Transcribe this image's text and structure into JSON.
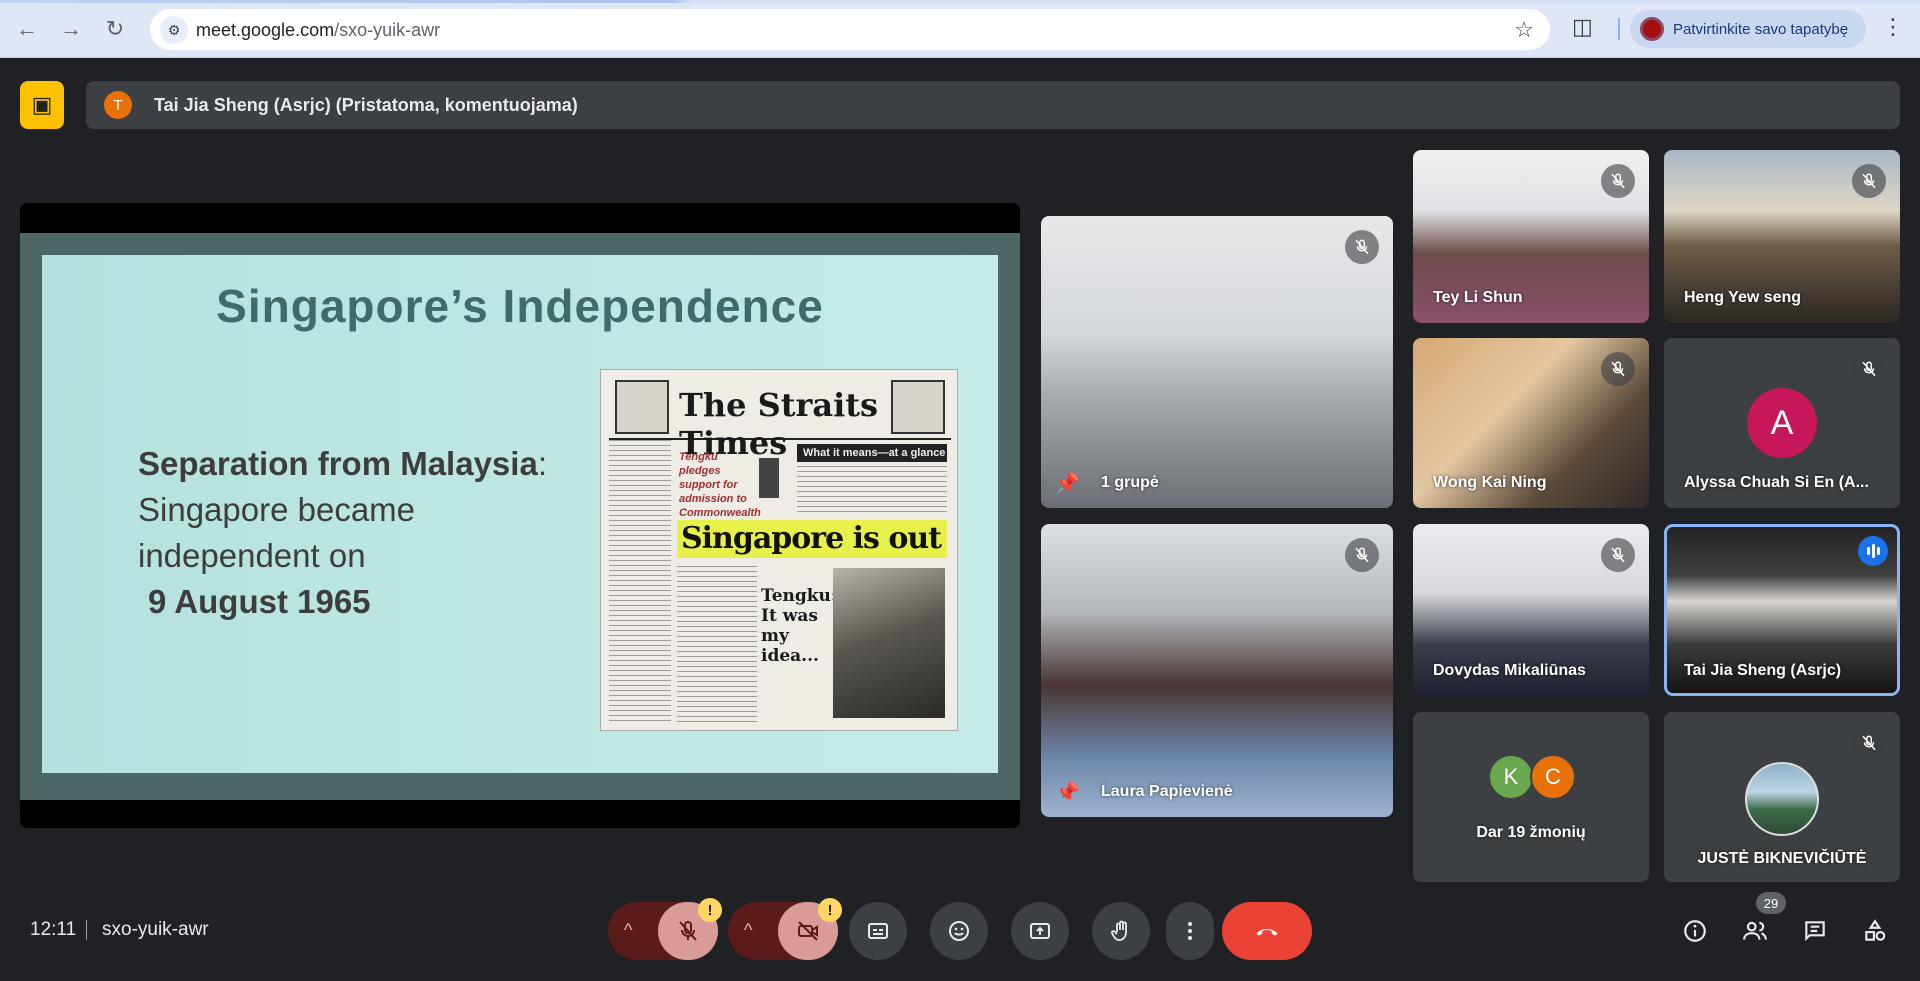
{
  "browser": {
    "url_host": "meet.google.com",
    "url_path": "/sxo-yuik-awr",
    "profile_label": "Patvirtinkite savo tapatybę"
  },
  "presenter": {
    "avatar_initial": "T",
    "label": "Tai Jia Sheng (Asrjc) (Pristatoma, komentuojama)"
  },
  "slide": {
    "title": "Singapore’s Independence",
    "heading_bold": "Separation from Malaysia",
    "heading_colon": ":",
    "body": "Singapore became independent on",
    "date": "9 August 1965",
    "newspaper": {
      "masthead": "The Straits Times",
      "subhead": "Tengku pledges support for admission to Commonwealth and United Nations",
      "glance": "What it means—at a glance",
      "headline": "Singapore is out",
      "quote": "Tengku: It was my idea..."
    }
  },
  "participants": [
    {
      "name": "1 grupė"
    },
    {
      "name": "Laura Papievienė"
    },
    {
      "name": "Tey Li Shun"
    },
    {
      "name": "Heng Yew seng"
    },
    {
      "name": "Wong Kai Ning"
    },
    {
      "name": "Alyssa Chuah Si En (A...",
      "initial": "A"
    },
    {
      "name": "Dovydas Mikaliūnas"
    },
    {
      "name": "Tai Jia Sheng (Asrjc)"
    },
    {
      "name": "Dar 19 žmonių",
      "initials": [
        "K",
        "C"
      ]
    },
    {
      "name": "JUSTĖ BIKNEVIČIŪTĖ"
    }
  ],
  "footer": {
    "time": "12:11",
    "meeting_code": "sxo-yuik-awr",
    "warn_symbol": "!",
    "people_count": "29"
  },
  "colors": {
    "background": "#202124",
    "tile": "#3c4043",
    "presenting_accent": "#fdc100",
    "hangup": "#ea4335",
    "active_speaker": "#8ab4f8",
    "avatar_a": "#c5175a",
    "avatar_k": "#6aa84f",
    "avatar_c": "#e8710a"
  },
  "icons": {
    "back": "arrow-left-icon",
    "forward": "arrow-right-icon",
    "reload": "reload-icon",
    "star": "star-icon",
    "extensions": "puzzle-icon",
    "present": "presentation-off-icon",
    "mic_off": "mic-off-icon",
    "cam_off": "camera-off-icon",
    "captions": "captions-icon",
    "emoji": "emoji-icon",
    "share": "present-screen-icon",
    "hand": "raise-hand-icon",
    "more": "more-vert-icon",
    "hangup": "call-end-icon",
    "info": "info-icon",
    "people": "people-icon",
    "chat": "chat-icon",
    "activities": "activities-icon"
  }
}
